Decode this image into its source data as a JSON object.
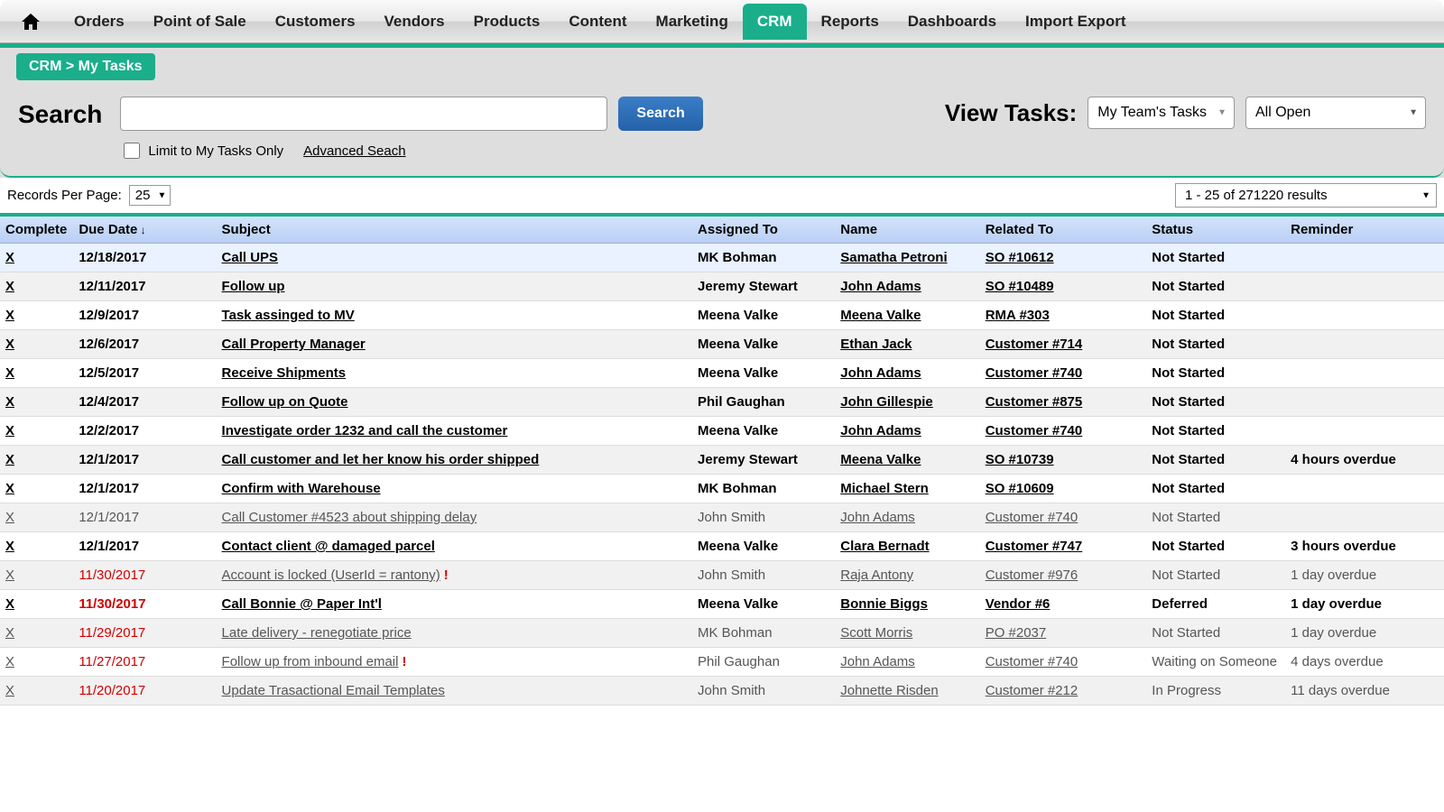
{
  "nav": {
    "items": [
      "Orders",
      "Point of Sale",
      "Customers",
      "Vendors",
      "Products",
      "Content",
      "Marketing",
      "CRM",
      "Reports",
      "Dashboards",
      "Import Export"
    ],
    "active_index": 7
  },
  "breadcrumb": "CRM > My Tasks",
  "search": {
    "label": "Search",
    "button": "Search",
    "limit_label": "Limit to My Tasks Only",
    "advanced_label": "Advanced Seach"
  },
  "view": {
    "label": "View Tasks:",
    "team_filter": "My Team's Tasks",
    "status_filter": "All Open"
  },
  "records": {
    "per_page_label": "Records Per Page:",
    "per_page_value": "25",
    "results_text": "1 - 25 of 271220 results"
  },
  "columns": [
    "Complete",
    "Due Date",
    "Subject",
    "Assigned To",
    "Name",
    "Related To",
    "Status",
    "Reminder"
  ],
  "sort_indicator": " ↓",
  "rows": [
    {
      "x": "X",
      "date": "12/18/2017",
      "subject": "Call UPS",
      "assigned": "MK Bohman",
      "name": "Samatha Petroni",
      "related": "SO #10612",
      "status": "Not Started",
      "reminder": "",
      "bold": true,
      "red": false,
      "dim": false,
      "excl": false
    },
    {
      "x": "X",
      "date": "12/11/2017",
      "subject": "Follow up",
      "assigned": "Jeremy Stewart",
      "name": "John Adams",
      "related": "SO #10489",
      "status": "Not Started",
      "reminder": "",
      "bold": true,
      "red": false,
      "dim": false,
      "excl": false
    },
    {
      "x": "X",
      "date": "12/9/2017",
      "subject": "Task assinged to MV",
      "assigned": "Meena Valke",
      "name": "Meena Valke",
      "related": "RMA #303",
      "status": "Not Started",
      "reminder": "",
      "bold": true,
      "red": false,
      "dim": false,
      "excl": false
    },
    {
      "x": "X",
      "date": "12/6/2017",
      "subject": "Call Property Manager",
      "assigned": "Meena Valke",
      "name": "Ethan Jack",
      "related": "Customer #714",
      "status": "Not Started",
      "reminder": "",
      "bold": true,
      "red": false,
      "dim": false,
      "excl": false
    },
    {
      "x": "X",
      "date": "12/5/2017",
      "subject": "Receive Shipments",
      "assigned": "Meena Valke",
      "name": "John Adams",
      "related": "Customer #740",
      "status": "Not Started",
      "reminder": "",
      "bold": true,
      "red": false,
      "dim": false,
      "excl": false
    },
    {
      "x": "X",
      "date": "12/4/2017",
      "subject": "Follow up on Quote",
      "assigned": "Phil Gaughan",
      "name": "John Gillespie",
      "related": "Customer #875",
      "status": "Not Started",
      "reminder": "",
      "bold": true,
      "red": false,
      "dim": false,
      "excl": false
    },
    {
      "x": "X",
      "date": "12/2/2017",
      "subject": "Investigate order 1232 and call the customer",
      "assigned": "Meena Valke",
      "name": "John Adams",
      "related": "Customer #740",
      "status": "Not Started",
      "reminder": "",
      "bold": true,
      "red": false,
      "dim": false,
      "excl": false
    },
    {
      "x": "X",
      "date": "12/1/2017",
      "subject": "Call customer and let her know his order shipped",
      "assigned": "Jeremy Stewart",
      "name": "Meena Valke",
      "related": "SO #10739",
      "status": "Not Started",
      "reminder": "4 hours overdue",
      "bold": true,
      "red": false,
      "dim": false,
      "excl": false
    },
    {
      "x": "X",
      "date": "12/1/2017",
      "subject": "Confirm with Warehouse",
      "assigned": "MK Bohman",
      "name": "Michael Stern",
      "related": "SO #10609",
      "status": "Not Started",
      "reminder": "",
      "bold": true,
      "red": false,
      "dim": false,
      "excl": false
    },
    {
      "x": "X",
      "date": "12/1/2017",
      "subject": "Call Customer #4523 about shipping delay",
      "assigned": "John Smith",
      "name": "John Adams",
      "related": "Customer #740",
      "status": "Not Started",
      "reminder": "",
      "bold": false,
      "red": false,
      "dim": true,
      "excl": false
    },
    {
      "x": "X",
      "date": "12/1/2017",
      "subject": "Contact client @ damaged parcel",
      "assigned": "Meena Valke",
      "name": "Clara Bernadt",
      "related": "Customer #747",
      "status": "Not Started",
      "reminder": "3 hours overdue",
      "bold": true,
      "red": false,
      "dim": false,
      "excl": false
    },
    {
      "x": "X",
      "date": "11/30/2017",
      "subject": "Account is locked (UserId = rantony)",
      "assigned": "John Smith",
      "name": "Raja Antony",
      "related": "Customer #976",
      "status": "Not Started",
      "reminder": "1 day overdue",
      "bold": false,
      "red": true,
      "dim": true,
      "excl": true
    },
    {
      "x": "X",
      "date": "11/30/2017",
      "subject": "Call Bonnie @ Paper Int'l",
      "assigned": "Meena Valke",
      "name": "Bonnie Biggs",
      "related": "Vendor #6",
      "status": "Deferred",
      "reminder": "1 day overdue",
      "bold": true,
      "red": true,
      "dim": false,
      "excl": false
    },
    {
      "x": "X",
      "date": "11/29/2017",
      "subject": "Late delivery - renegotiate price",
      "assigned": "MK Bohman",
      "name": "Scott Morris",
      "related": "PO #2037",
      "status": "Not Started",
      "reminder": "1 day overdue",
      "bold": false,
      "red": true,
      "dim": true,
      "excl": false
    },
    {
      "x": "X",
      "date": "11/27/2017",
      "subject": "Follow up from inbound email",
      "assigned": "Phil Gaughan",
      "name": "John Adams",
      "related": "Customer #740",
      "status": "Waiting on Someone",
      "reminder": "4 days overdue",
      "bold": false,
      "red": true,
      "dim": true,
      "excl": true
    },
    {
      "x": "X",
      "date": "11/20/2017",
      "subject": "Update Trasactional Email Templates",
      "assigned": "John Smith",
      "name": "Johnette Risden",
      "related": "Customer #212",
      "status": "In Progress",
      "reminder": "11 days overdue",
      "bold": false,
      "red": true,
      "dim": true,
      "excl": false
    }
  ]
}
